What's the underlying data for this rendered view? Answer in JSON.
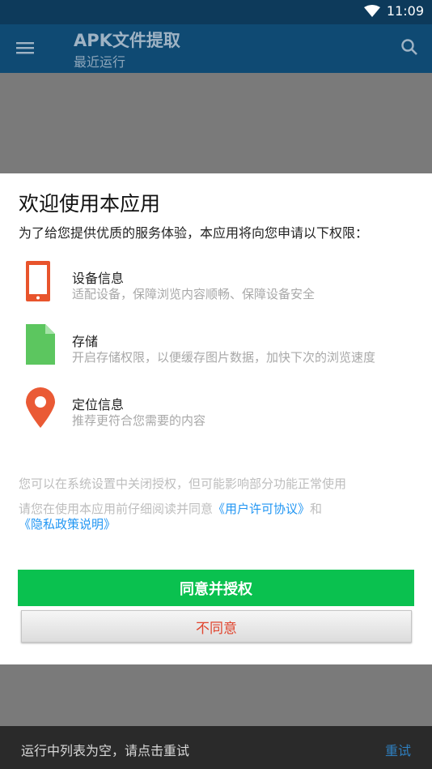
{
  "status_bar": {
    "time": "11:09",
    "icons": [
      "wifi-icon"
    ]
  },
  "app_bar": {
    "title": "APK文件提取",
    "subtitle": "最近运行",
    "icons": [
      "menu-icon",
      "search-icon"
    ]
  },
  "dialog": {
    "title": "欢迎使用本应用",
    "intro": "为了给您提供优质的服务体验，本应用将向您申请以下权限：",
    "permissions": [
      {
        "icon": "phone-icon",
        "color": "#e8542c",
        "title": "设备信息",
        "desc": "适配设备，保障浏览内容顺畅、保障设备安全"
      },
      {
        "icon": "file-icon",
        "color": "#5cc65f",
        "title": "存储",
        "desc": "开启存储权限，以便缓存图片数据，加快下次的浏览速度"
      },
      {
        "icon": "location-pin-icon",
        "color": "#ea5a35",
        "title": "定位信息",
        "desc": "推荐更符合您需要的内容"
      }
    ],
    "note_settings": "您可以在系统设置中关闭授权，但可能影响部分功能正常使用",
    "note_read_prefix": "请您在使用本应用前仔细阅读并同意",
    "link_user_agreement": "《用户许可协议》",
    "note_and": "和",
    "link_privacy": "《隐私政策说明》",
    "agree_button": "同意并授权",
    "disagree_button": "不同意"
  },
  "snackbar": {
    "message": "运行中列表为空，请点击重试",
    "action": "重试"
  },
  "colors": {
    "status_bar": "#0d3a5b",
    "app_bar": "#0f4a73",
    "agree": "#0ac14f",
    "disagree_text": "#e0452f",
    "link": "#2196f3"
  }
}
